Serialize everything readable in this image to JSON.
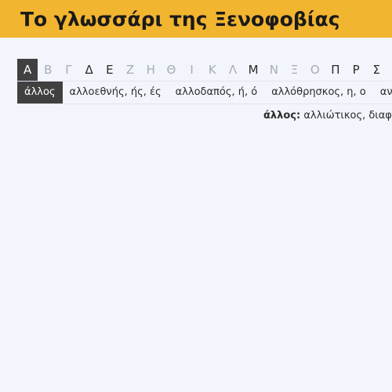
{
  "header": {
    "title": "Το γλωσσάρι της Ξενοφοβίας",
    "background": "#f2b530"
  },
  "alphabet": {
    "letters": [
      {
        "label": "Α",
        "state": "active"
      },
      {
        "label": "Β",
        "state": "disabled"
      },
      {
        "label": "Γ",
        "state": "disabled"
      },
      {
        "label": "Δ",
        "state": "has"
      },
      {
        "label": "Ε",
        "state": "has"
      },
      {
        "label": "Ζ",
        "state": "disabled"
      },
      {
        "label": "Η",
        "state": "disabled"
      },
      {
        "label": "Θ",
        "state": "disabled"
      },
      {
        "label": "Ι",
        "state": "disabled"
      },
      {
        "label": "Κ",
        "state": "disabled"
      },
      {
        "label": "Λ",
        "state": "disabled"
      },
      {
        "label": "Μ",
        "state": "has"
      },
      {
        "label": "Ν",
        "state": "disabled"
      },
      {
        "label": "Ξ",
        "state": "disabled"
      },
      {
        "label": "Ο",
        "state": "disabled"
      },
      {
        "label": "Π",
        "state": "has"
      },
      {
        "label": "Ρ",
        "state": "has"
      },
      {
        "label": "Σ",
        "state": "has"
      }
    ]
  },
  "words": {
    "items": [
      {
        "label": "άλλος",
        "active": true
      },
      {
        "label": "αλλοεθνής, ής, ές",
        "active": false
      },
      {
        "label": "αλλοδαπός, ή, ό",
        "active": false
      },
      {
        "label": "αλλόθρησκος, η, ο",
        "active": false
      },
      {
        "label": "ανα",
        "active": false
      }
    ]
  },
  "definition": {
    "term": "άλλος:",
    "text": " αλλιώτικος, διαφο"
  },
  "colors": {
    "accent": "#f2b530",
    "active_bg": "#404040",
    "page_bg": "#f3f5fc"
  }
}
